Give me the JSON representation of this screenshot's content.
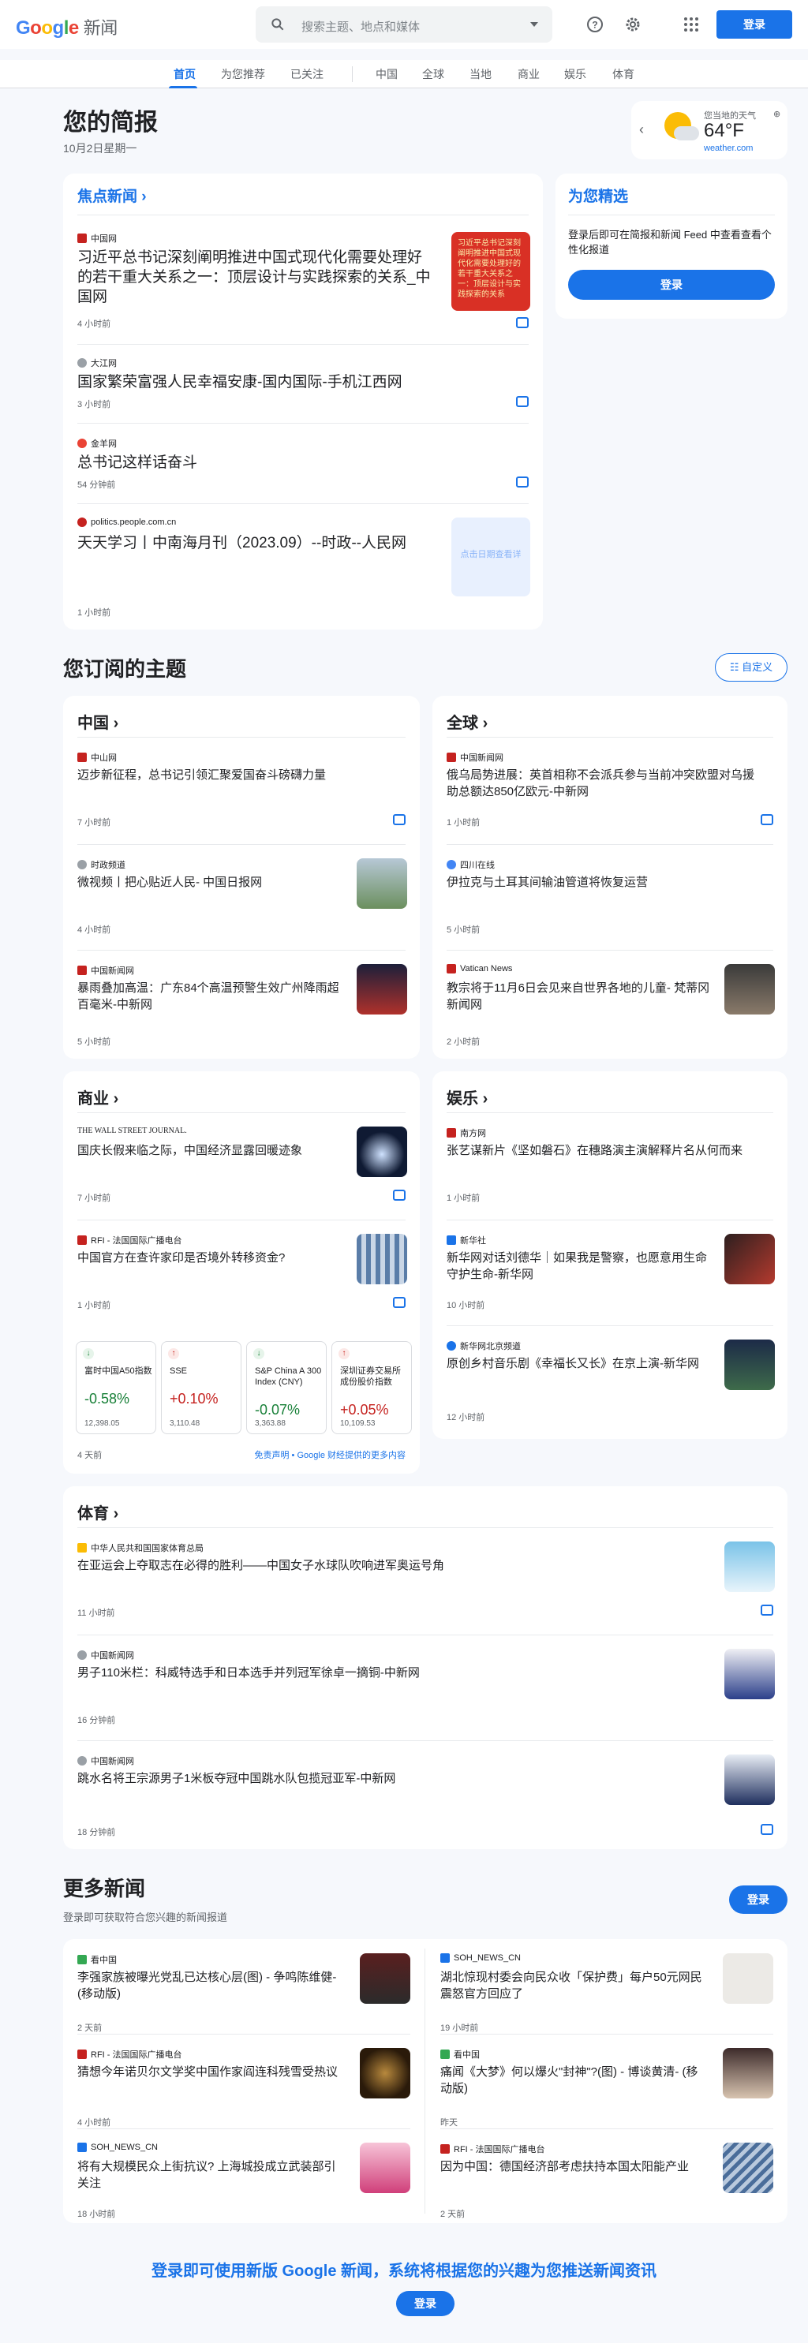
{
  "header": {
    "logo_letters": [
      "G",
      "o",
      "o",
      "g",
      "l",
      "e"
    ],
    "logo_suffix": "新闻",
    "search_placeholder": "搜索主题、地点和媒体",
    "signin": "登录"
  },
  "nav": {
    "tabs": [
      "首页",
      "为您推荐",
      "已关注",
      "中国",
      "全球",
      "当地",
      "商业",
      "娱乐",
      "体育"
    ]
  },
  "briefing": {
    "title": "您的简报",
    "date": "10月2日星期一"
  },
  "weather": {
    "location": "您当地的天气",
    "temp": "64°F",
    "source": "weather.com"
  },
  "top_stories": {
    "title": "焦点新闻",
    "stories": [
      {
        "source": "中国网",
        "headline": "习近平总书记深刻阐明推进中国式现代化需要处理好的若干重大关系之一：顶层设计与实践探索的关系_中国网",
        "time": "4 小时前",
        "thumb_text": "习近平总书记深刻阐明推进中国式现代化需要处理好的若干重大关系之一：顶层设计与实践探索的关系"
      },
      {
        "source": "大江网",
        "headline": "国家繁荣富强人民幸福安康-国内国际-手机江西网",
        "time": "3 小时前"
      },
      {
        "source": "金羊网",
        "headline": "总书记这样话奋斗",
        "time": "54 分钟前"
      },
      {
        "source": "politics.people.com.cn",
        "headline": "天天学习丨中南海月刊（2023.09）--时政--人民网",
        "time": "1 小时前",
        "thumb_text": "点击日期查看详"
      }
    ]
  },
  "for_you": {
    "title": "为您精选",
    "desc": "登录后即可在简报和新闻 Feed 中查看查看个性化报道",
    "button": "登录"
  },
  "topics": {
    "title": "您订阅的主题",
    "customize": "自定义",
    "china": {
      "title": "中国",
      "stories": [
        {
          "source": "中山网",
          "headline": "迈步新征程，总书记引领汇聚爱国奋斗磅礴力量",
          "time": "7 小时前"
        },
        {
          "source": "时政频道",
          "headline": "微视频丨把心贴近人民- 中国日报网",
          "time": "4 小时前"
        },
        {
          "source": "中国新闻网",
          "headline": "暴雨叠加高温：广东84个高温预警生效广州降雨超百毫米-中新网",
          "time": "5 小时前"
        }
      ]
    },
    "world": {
      "title": "全球",
      "stories": [
        {
          "source": "中国新闻网",
          "headline": "俄乌局势进展：英首相称不会派兵参与当前冲突欧盟对乌援助总额达850亿欧元-中新网",
          "time": "1 小时前"
        },
        {
          "source": "四川在线",
          "headline": "伊拉克与土耳其间输油管道将恢复运营",
          "time": "5 小时前"
        },
        {
          "source": "Vatican News",
          "headline": "教宗将于11月6日会见来自世界各地的儿童- 梵蒂冈新闻网",
          "time": "2 小时前"
        }
      ]
    },
    "business": {
      "title": "商业",
      "stories": [
        {
          "source": "THE WALL STREET JOURNAL.",
          "headline": "国庆长假来临之际，中国经济显露回暖迹象",
          "time": "7 小时前"
        },
        {
          "source": "RFI - 法国国际广播电台",
          "headline": "中国官方在查许家印是否境外转移资金?",
          "time": "1 小时前"
        }
      ],
      "stocks": [
        {
          "name": "富时中国A50指数",
          "change": "-0.58%",
          "value": "12,398.05",
          "up": false
        },
        {
          "name": "SSE",
          "change": "+0.10%",
          "value": "3,110.48",
          "up": true
        },
        {
          "name": "S&P China A 300 Index (CNY)",
          "change": "-0.07%",
          "value": "3,363.88",
          "up": false
        },
        {
          "name": "深圳证券交易所成份股价指数",
          "change": "+0.05%",
          "value": "10,109.53",
          "up": true
        }
      ],
      "stocks_time": "4 天前",
      "disclaimer": "免责声明 • Google 财经提供的更多内容"
    },
    "entertainment": {
      "title": "娱乐",
      "stories": [
        {
          "source": "南方网",
          "headline": "张艺谋新片《坚如磐石》在穗路演主演解释片名从何而来",
          "time": "1 小时前"
        },
        {
          "source": "新华社",
          "headline": "新华网对话刘德华｜如果我是警察，也愿意用生命守护生命-新华网",
          "time": "10 小时前"
        },
        {
          "source": "新华网北京频道",
          "headline": "原创乡村音乐剧《幸福长又长》在京上演-新华网",
          "time": "12 小时前"
        }
      ]
    },
    "sports": {
      "title": "体育",
      "stories": [
        {
          "source": "中华人民共和国国家体育总局",
          "headline": "在亚运会上夺取志在必得的胜利——中国女子水球队吹响进军奥运号角",
          "time": "11 小时前"
        },
        {
          "source": "中国新闻网",
          "headline": "男子110米栏：科威特选手和日本选手并列冠军徐卓一摘铜-中新网",
          "time": "16 分钟前"
        },
        {
          "source": "中国新闻网",
          "headline": "跳水名将王宗源男子1米板夺冠中国跳水队包揽冠亚军-中新网",
          "time": "18 分钟前"
        }
      ]
    }
  },
  "more_news": {
    "title": "更多新闻",
    "subtitle": "登录即可获取符合您兴趣的新闻报道",
    "button": "登录",
    "stories": [
      {
        "source": "看中国",
        "headline": "李强家族被曝光党乱已达核心层(图) - 争鸣陈维健- (移动版)",
        "time": "2 天前"
      },
      {
        "source": "SOH_NEWS_CN",
        "headline": "湖北惊现村委会向民众收「保护费」每户50元网民震怒官方回应了",
        "time": "19 小时前"
      },
      {
        "source": "RFI - 法国国际广播电台",
        "headline": "猜想今年诺贝尔文学奖中国作家阎连科残雪受热议",
        "time": "4 小时前"
      },
      {
        "source": "看中国",
        "headline": "痛闻《大梦》何以爆火\"封神\"?(图) - 博谈黄清- (移动版)",
        "time": "昨天"
      },
      {
        "source": "SOH_NEWS_CN",
        "headline": "将有大规模民众上街抗议? 上海城投成立武装部引关注",
        "time": "18 小时前"
      },
      {
        "source": "RFI - 法国国际广播电台",
        "headline": "因为中国：德国经济部考虑扶持本国太阳能产业",
        "time": "2 天前"
      }
    ]
  },
  "footer": {
    "cta": "登录即可使用新版 Google 新闻，系统将根据您的兴趣为您推送新闻资讯",
    "button": "登录"
  },
  "colors": {
    "accent": "#1a73e8",
    "up": "#c5221f",
    "down": "#188038"
  }
}
